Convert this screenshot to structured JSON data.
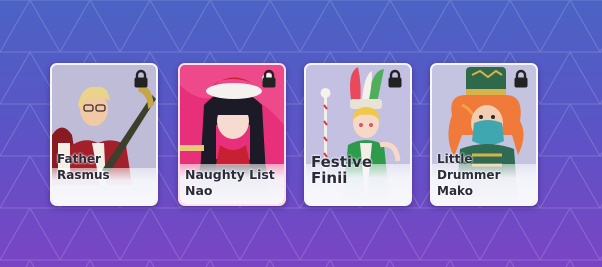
{
  "characters": [
    {
      "name": "Father Rasmus",
      "locked": true,
      "lock_icon": "padlock-icon",
      "bg": "#bfbcd8"
    },
    {
      "name": "Naughty List Nao",
      "locked": true,
      "lock_icon": "padlock-icon",
      "bg": "#e8307a"
    },
    {
      "name": "Festive Finii",
      "locked": true,
      "lock_icon": "padlock-icon",
      "bg": "#c3c0e2"
    },
    {
      "name": "Little Drummer Mako",
      "locked": true,
      "lock_icon": "padlock-icon",
      "bg": "#c4c3e0"
    }
  ]
}
